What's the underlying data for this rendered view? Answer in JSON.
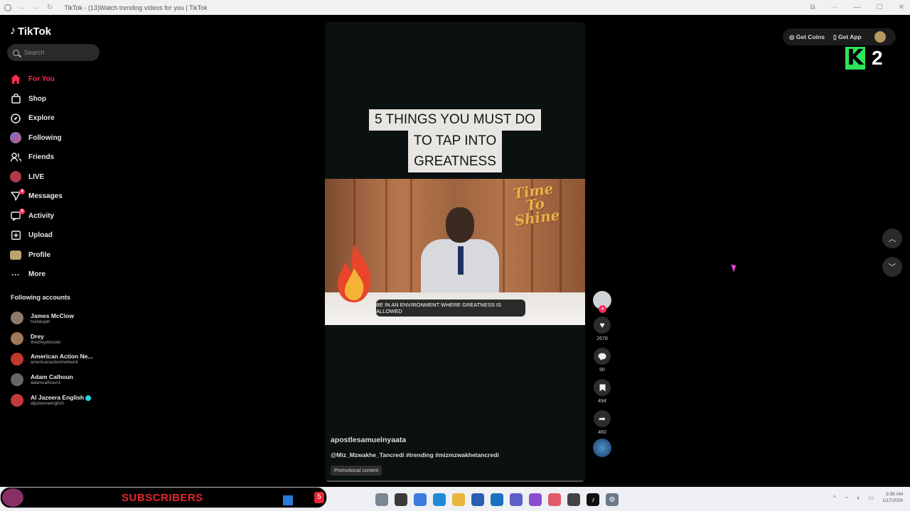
{
  "browser": {
    "tab_title": "TikTok - (13)Watch trending videos for you | TikTok"
  },
  "sidebar": {
    "logo": "TikTok",
    "search_placeholder": "Search",
    "nav": [
      {
        "label": "For You",
        "icon": "home-icon",
        "active": true
      },
      {
        "label": "Shop",
        "icon": "shopping-bag-icon"
      },
      {
        "label": "Explore",
        "icon": "compass-icon"
      },
      {
        "label": "Following",
        "icon": "avatar-icon"
      },
      {
        "label": "Friends",
        "icon": "friends-icon"
      },
      {
        "label": "LIVE",
        "icon": "live-icon"
      },
      {
        "label": "Messages",
        "icon": "messages-icon",
        "badge": "4"
      },
      {
        "label": "Activity",
        "icon": "activity-icon",
        "badge": "9"
      },
      {
        "label": "Upload",
        "icon": "upload-icon"
      },
      {
        "label": "Profile",
        "icon": "profile-icon"
      },
      {
        "label": "More",
        "icon": "more-dots-icon"
      }
    ],
    "following_title": "Following accounts",
    "accounts": [
      {
        "name": "James McClow",
        "handle": "hullalujah",
        "color": "#8c7a6a"
      },
      {
        "name": "Drey",
        "handle": "thedreydossier",
        "color": "#a0785a"
      },
      {
        "name": "American Action Ne...",
        "handle": "americanactionnetwork",
        "color": "#c0392b"
      },
      {
        "name": "Adam Calhoun",
        "handle": "adamcalhoun1",
        "color": "#666"
      },
      {
        "name": "Al Jazeera English",
        "handle": "aljazeeraenglish",
        "color": "#c23a3a",
        "verified": true
      }
    ]
  },
  "video": {
    "headline": [
      "5 THINGS YOU MUST DO",
      "TO TAP INTO",
      "GREATNESS"
    ],
    "shine_text": [
      "Time",
      "To",
      "Shine"
    ],
    "banner_text": "BE IN AN ENVIRONMENT WHERE GREATNESS IS ALLOWED",
    "creator": "apostlesamuelnyaata",
    "caption": "@Miz_Mzwakhe_Tancredi #trending #mizmzwakhetancredi",
    "promo_label": "Promotional content"
  },
  "actions": {
    "likes": "2678",
    "comments": "90",
    "saves": "494",
    "shares": "460"
  },
  "topbar": {
    "get_coins": "Get Coins",
    "get_app": "Get App"
  },
  "overlay": {
    "k_letter": "K",
    "k_number": "2",
    "subscribers_label": "SUBSCRIBERS",
    "subscribers_count": "5"
  },
  "taskbar": {
    "time": "3:38 AM",
    "date": "1/17/2026"
  },
  "colors": {
    "accent": "#fe2c55",
    "k_green": "#2fe35a",
    "subs_red": "#e8252e"
  }
}
